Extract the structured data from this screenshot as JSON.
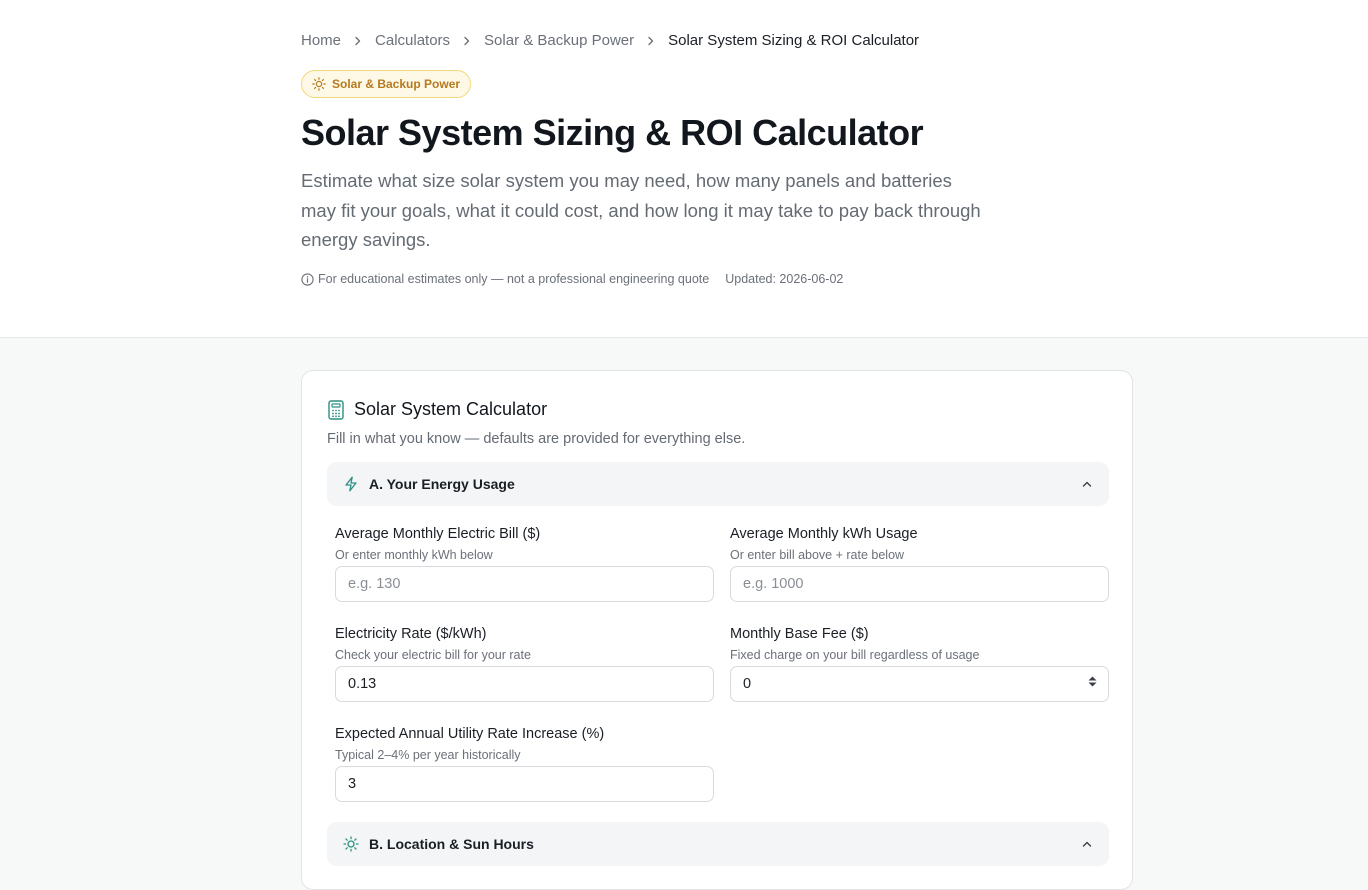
{
  "breadcrumb": {
    "items": [
      "Home",
      "Calculators",
      "Solar & Backup Power"
    ],
    "current": "Solar System Sizing & ROI Calculator"
  },
  "badge": {
    "label": "Solar & Backup Power",
    "icon": "sun-icon",
    "color": "#b7791f"
  },
  "page": {
    "title": "Solar System Sizing & ROI Calculator",
    "lead": "Estimate what size solar system you may need, how many panels and batteries may fit your goals, what it could cost, and how long it may take to pay back through energy savings.",
    "disclaimer": "For educational estimates only — not a professional engineering quote",
    "updated": "Updated: 2026-06-02"
  },
  "calculator": {
    "title": "Solar System Calculator",
    "subtitle": "Fill in what you know — defaults are provided for everything else.",
    "accent": "#2f8f83",
    "sections": [
      {
        "label": "A. Your Energy Usage",
        "icon": "lightning-icon",
        "expanded": true
      },
      {
        "label": "B. Location & Sun Hours",
        "icon": "sun-icon",
        "expanded": true
      }
    ],
    "fields": {
      "monthly_bill": {
        "label": "Average Monthly Electric Bill ($)",
        "help": "Or enter monthly kWh below",
        "placeholder": "e.g. 130",
        "value": ""
      },
      "monthly_kwh": {
        "label": "Average Monthly kWh Usage",
        "help": "Or enter bill above + rate below",
        "placeholder": "e.g. 1000",
        "value": ""
      },
      "rate": {
        "label": "Electricity Rate ($/kWh)",
        "help": "Check your electric bill for your rate",
        "value": "0.13"
      },
      "base_fee": {
        "label": "Monthly Base Fee ($)",
        "help": "Fixed charge on your bill regardless of usage",
        "value": "0"
      },
      "rate_increase": {
        "label": "Expected Annual Utility Rate Increase (%)",
        "help": "Typical 2–4% per year historically",
        "value": "3"
      }
    }
  }
}
